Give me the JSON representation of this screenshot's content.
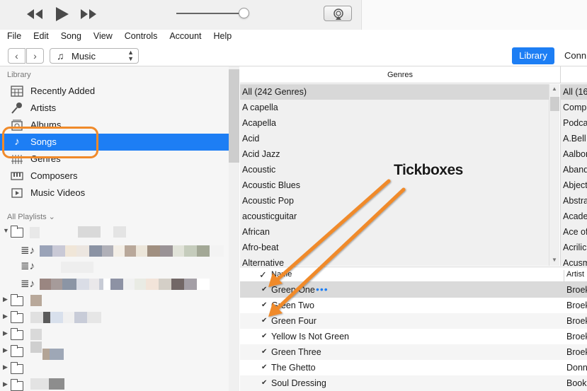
{
  "menu": [
    "File",
    "Edit",
    "Song",
    "View",
    "Controls",
    "Account",
    "Help"
  ],
  "volume_level": 0.92,
  "nav": {
    "media_kind": "Music",
    "library_button": "Library",
    "connect_tab": "Conn"
  },
  "sidebar": {
    "library_header": "Library",
    "items": [
      {
        "label": "Recently Added",
        "icon": "grid-calendar-icon"
      },
      {
        "label": "Artists",
        "icon": "microphone-icon"
      },
      {
        "label": "Albums",
        "icon": "album-stack-icon"
      },
      {
        "label": "Songs",
        "icon": "music-note-icon",
        "selected": true
      },
      {
        "label": "Genres",
        "icon": "guitar-icon"
      },
      {
        "label": "Composers",
        "icon": "piano-icon"
      },
      {
        "label": "Music Videos",
        "icon": "video-icon"
      }
    ],
    "playlists_header": "All Playlists ⌄"
  },
  "browser": {
    "genres_header": "Genres",
    "genres": [
      "All (242 Genres)",
      "A capella",
      "Acapella",
      "Acid",
      "Acid Jazz",
      "Acoustic",
      "Acoustic Blues",
      "Acoustic Pop",
      "acousticguitar",
      "African",
      "Afro-beat",
      "Alternative"
    ],
    "artists": [
      "All (16",
      "Compi",
      "Podca",
      "A.Bell",
      "Aalbor",
      "Aband",
      "Abject",
      "Abstra",
      "Acade",
      "Ace of",
      "Acrilic",
      "Acusm"
    ]
  },
  "songs": {
    "header_check": "✓",
    "header_name": "Name",
    "header_artist": "Artist",
    "rows": [
      {
        "title": "Green One",
        "artist": "Broek",
        "checked": true
      },
      {
        "title": "Green Two",
        "artist": "Broek",
        "checked": true
      },
      {
        "title": "Green Four",
        "artist": "Broek",
        "checked": true
      },
      {
        "title": "Yellow Is Not Green",
        "artist": "Broek",
        "checked": true
      },
      {
        "title": "Green Three",
        "artist": "Broek",
        "checked": true
      },
      {
        "title": "The Ghetto",
        "artist": "Donn",
        "checked": true
      },
      {
        "title": "Soul Dressing",
        "artist": "Booke",
        "checked": true
      }
    ],
    "more_glyph": "•••"
  },
  "annotation": {
    "label": "Tickboxes",
    "color": "#f08a2a"
  },
  "colors": {
    "accent": "#1d7ef4",
    "annotation": "#f08a2a"
  }
}
